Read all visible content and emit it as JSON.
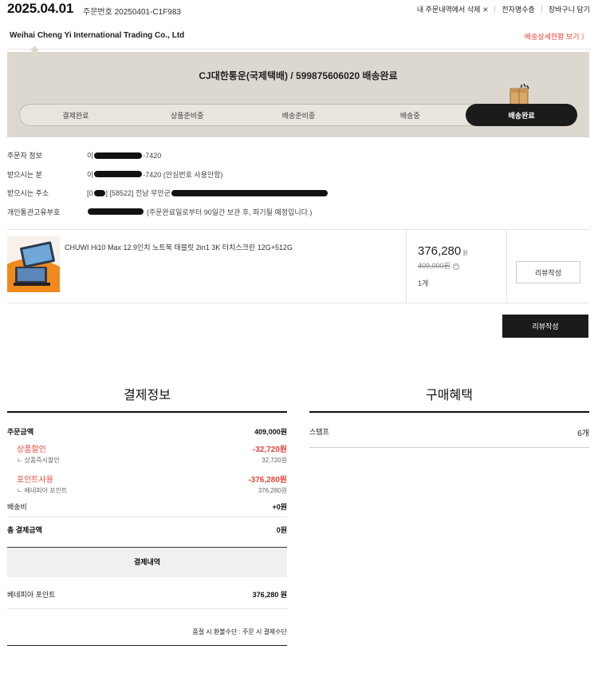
{
  "header": {
    "order_date": "2025.04.01",
    "order_no": "주문번호 20250401-C1F983",
    "actions": [
      "내 주문내역에서 삭제",
      "전자명수증",
      "장바구니 담기"
    ]
  },
  "seller": {
    "name": "Weihai Cheng Yi International Trading Co., Ltd",
    "ship_detail_link": "배송상세현황 보기 〉"
  },
  "shipping": {
    "status_text": "CJ대한통운(국제택배) / 599875606020 배송완료",
    "steps": [
      "결제완료",
      "상품준비중",
      "배송준비중",
      "배송중",
      "배송완료"
    ],
    "active_step_index": 4
  },
  "orderer_info": {
    "rows": [
      {
        "label": "주문자 정보",
        "prefix": "이",
        "suffix": "-7420"
      },
      {
        "label": "받으시는 분",
        "prefix": "이",
        "suffix": "-7420 (안심번호 사용안함)"
      },
      {
        "label": "받으시는 주소",
        "prefix": "[0",
        "suffix": "] [58522] 전남 무안군"
      },
      {
        "label": "개인통관고유부호",
        "prefix": "",
        "suffix": "(주문완료일로부터 90일간 보관 후, 파기될 예정입니다.)"
      }
    ]
  },
  "product": {
    "name": "CHUWI Hi10 Max 12.9인치 노트북 태블릿 2in1 3K 터치스크린 12G+512G",
    "price": "376,280",
    "price_unit": "원",
    "original_price": "409,000원",
    "quantity": "1개",
    "review_button": "리뷰작성"
  },
  "review_button_main": "리뷰작성",
  "payment": {
    "title": "결제정보",
    "order_amount_label": "주문금액",
    "order_amount": "409,000원",
    "product_discount_label": "상품할인",
    "product_discount": "-32,720원",
    "instant_discount_label": "ㄴ 상품즉시할인",
    "instant_discount": "32,720원",
    "point_use_label": "포인트사용",
    "point_use": "-376,280원",
    "benepia_label": "ㄴ 베네피아 포인트",
    "benepia_value": "376,280원",
    "shipping_fee_label": "배송비",
    "shipping_fee": "+0원",
    "total_label": "총 결제금액",
    "total": "0원",
    "history_title": "결제내역",
    "history_item_label": "베네피아 포인트",
    "history_item_value": "376,280 원",
    "footer_note": "품절 시 환불수단 : 주문 시 결제수단"
  },
  "benefits": {
    "title": "구매혜택",
    "stamp_label": "스탬프",
    "stamp_value": "6개"
  },
  "colors": {
    "accent_red": "#e8463a",
    "status_bg": "#ddd8cf",
    "dark": "#1b1b1b"
  }
}
